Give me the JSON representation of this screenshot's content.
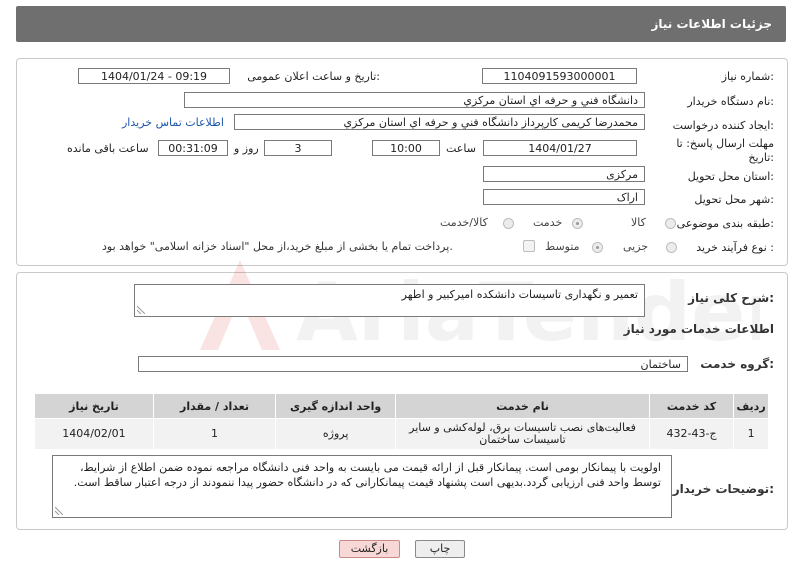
{
  "header": {
    "title": "جزئیات اطلاعات نیاز"
  },
  "form": {
    "need_number": {
      "label": "شماره نیاز:",
      "value": "1104091593000001"
    },
    "announce_datetime": {
      "label": "تاریخ و ساعت اعلان عمومی:",
      "value": "1404/01/24 - 09:19"
    },
    "buyer_org": {
      "label": "نام دستگاه خریدار:",
      "value": "دانشگاه فني و حرفه اي استان مرکزي"
    },
    "requester": {
      "label": "ایجاد کننده درخواست:",
      "value": "محمدرضا کریمی کارپرداز  دانشگاه فني و حرفه اي استان مرکزي",
      "contact_link": "اطلاعات تماس خریدار"
    },
    "deadline": {
      "label_line1": "مهلت ارسال پاسخ: تا",
      "label_line2": "تاریخ:",
      "date": "1404/01/27",
      "time_label": "ساعت",
      "time": "10:00",
      "days": "3",
      "days_label": "روز و",
      "remaining": "00:31:09",
      "remaining_label": "ساعت باقی مانده"
    },
    "delivery_province": {
      "label": "استان محل تحویل:",
      "value": "مرکزی"
    },
    "delivery_city": {
      "label": "شهر محل تحویل:",
      "value": "اراک"
    },
    "category": {
      "label": "طبقه بندی موضوعی:",
      "options": [
        "کالا",
        "خدمت",
        "کالا/خدمت"
      ],
      "selected": "خدمت"
    },
    "purchase_type": {
      "label": "نوع فرآیند خرید :",
      "options": [
        "جزیی",
        "متوسط"
      ],
      "selected": "متوسط",
      "treasury_note": "پرداخت تمام یا بخشی از مبلغ خرید،از محل \"اسناد خزانه اسلامی\" خواهد بود."
    }
  },
  "description": {
    "label": "شرح کلی نیاز:",
    "value": "تعمیر و نگهداری تاسیسات دانشکده امیرکبیر و اطهر"
  },
  "services": {
    "section_title": "اطلاعات خدمات مورد نیاز",
    "group_label": "گروه خدمت:",
    "group_value": "ساختمان",
    "columns": [
      "ردیف",
      "کد خدمت",
      "نام خدمت",
      "واحد اندازه گیری",
      "تعداد / مقدار",
      "تاریخ نیاز"
    ],
    "rows": [
      {
        "row": "1",
        "code": "ج-43-432",
        "name": "فعالیت‌های نصب تاسیسات برق، لوله‌کشی و سایر تاسیسات ساختمان",
        "unit": "پروژه",
        "qty": "1",
        "date": "1404/02/01"
      }
    ]
  },
  "buyer_notes": {
    "label": "توضیحات خریدار:",
    "value": "اولویت با پیمانکار بومی است. پیمانکار قبل از ارائه قیمت می بایست به واحد فنی دانشگاه مراجعه نموده ضمن اطلاع از شرایط، توسط واحد فنی ارزیابی گردد.بدیهی است پشنهاد قیمت پیمانکارانی که در دانشگاه حضور پیدا ننمودند از درجه اعتبار ساقط است."
  },
  "buttons": {
    "print": "چاپ",
    "back": "بازگشت"
  },
  "watermark": {
    "text": "AriaTender.neT"
  }
}
